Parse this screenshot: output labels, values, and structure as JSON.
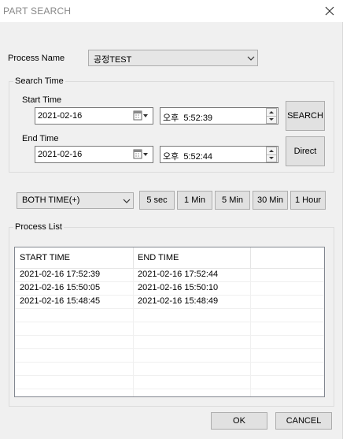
{
  "window": {
    "title": "PART SEARCH",
    "close_icon": "close-icon"
  },
  "process": {
    "label": "Process Name",
    "value": "공정TEST"
  },
  "search_time": {
    "group_label": "Search Time",
    "start_label": "Start Time",
    "start_date": "2021-02-16",
    "start_time": "오후  5:52:39",
    "end_label": "End Time",
    "end_date": "2021-02-16",
    "end_time": "오후  5:52:44"
  },
  "buttons": {
    "search": "SEARCH",
    "direct": "Direct",
    "ok": "OK",
    "cancel": "CANCEL"
  },
  "time_mode": {
    "value": "BOTH TIME(+)"
  },
  "quick": [
    "5 sec",
    "1 Min",
    "5 Min",
    "30 Min",
    "1 Hour"
  ],
  "process_list": {
    "group_label": "Process List",
    "columns": [
      "START TIME",
      "END TIME"
    ],
    "rows": [
      [
        "2021-02-16 17:52:39",
        "2021-02-16 17:52:44"
      ],
      [
        "2021-02-16 15:50:05",
        "2021-02-16 15:50:10"
      ],
      [
        "2021-02-16 15:48:45",
        "2021-02-16 15:48:49"
      ]
    ]
  }
}
